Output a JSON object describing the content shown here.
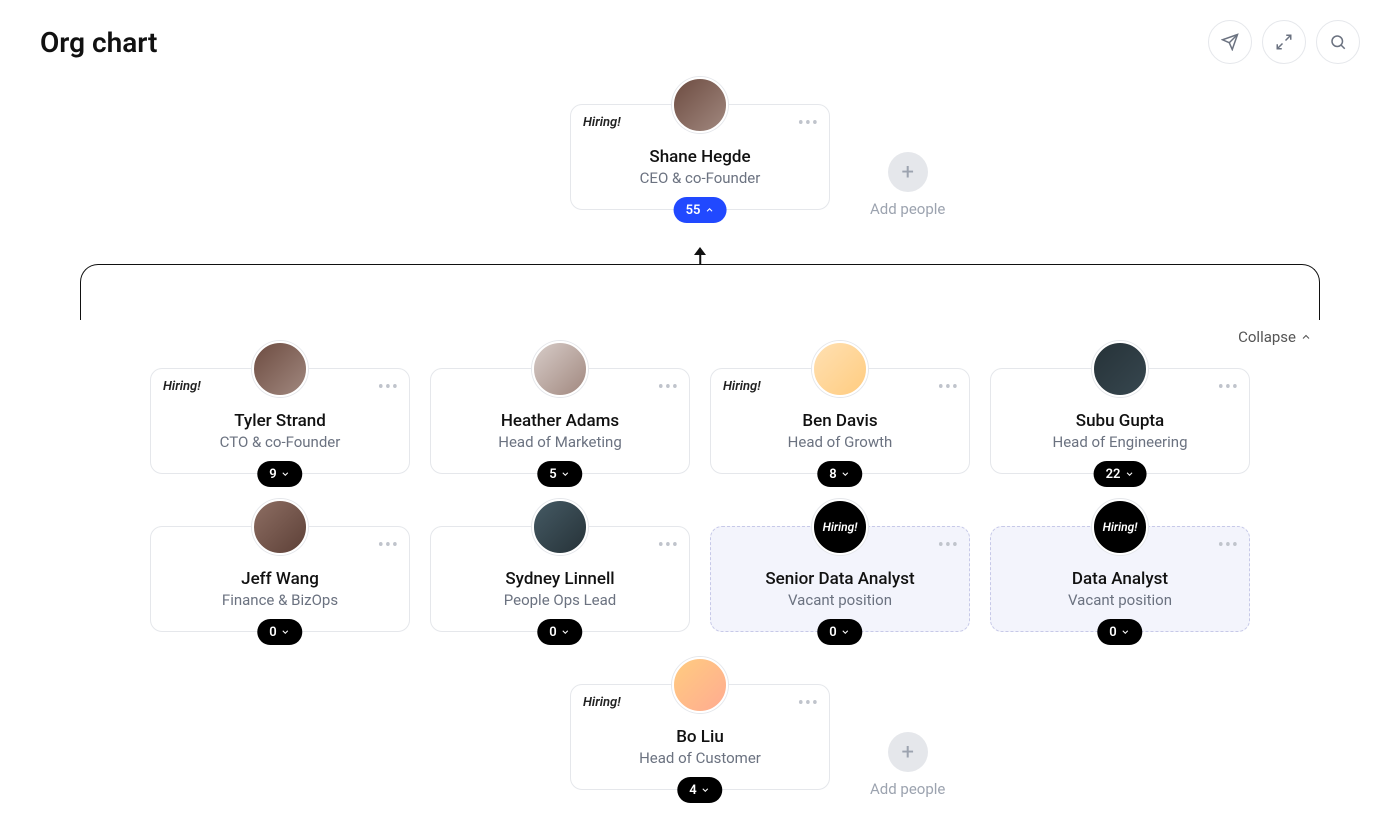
{
  "page_title": "Org chart",
  "collapse_label": "Collapse",
  "add_people_label": "Add people",
  "hiring_label": "Hiring!",
  "vacant_subtitle": "Vacant position",
  "root": {
    "name": "Shane Hegde",
    "title": "CEO & co-Founder",
    "hiring": true,
    "count": "55",
    "expanded": true
  },
  "children": [
    {
      "name": "Tyler Strand",
      "title": "CTO & co-Founder",
      "hiring": true,
      "count": "9"
    },
    {
      "name": "Heather Adams",
      "title": "Head of Marketing",
      "hiring": false,
      "count": "5"
    },
    {
      "name": "Ben Davis",
      "title": "Head of Growth",
      "hiring": true,
      "count": "8"
    },
    {
      "name": "Subu Gupta",
      "title": "Head of Engineering",
      "hiring": false,
      "count": "22"
    },
    {
      "name": "Jeff Wang",
      "title": "Finance & BizOps",
      "hiring": false,
      "count": "0"
    },
    {
      "name": "Sydney Linnell",
      "title": "People Ops Lead",
      "hiring": false,
      "count": "0"
    },
    {
      "name": "Senior Data Analyst",
      "title": "Vacant position",
      "vacant": true,
      "count": "0"
    },
    {
      "name": "Data Analyst",
      "title": "Vacant position",
      "vacant": true,
      "count": "0"
    }
  ],
  "footer": {
    "name": "Bo Liu",
    "title": "Head of Customer",
    "hiring": true,
    "count": "4"
  },
  "avatar_colors": [
    "linear-gradient(135deg,#6d4c41,#a1887f)",
    "linear-gradient(135deg,#d7ccc8,#a1887f)",
    "linear-gradient(135deg,#ffe0b2,#ffcc80)",
    "linear-gradient(135deg,#263238,#37474f)",
    "linear-gradient(135deg,#8d6e63,#5d4037)",
    "linear-gradient(135deg,#455a64,#263238)",
    "linear-gradient(135deg,#ef9a9a,#f48fb1)",
    "linear-gradient(135deg,#ffcc80,#ffab91)"
  ]
}
